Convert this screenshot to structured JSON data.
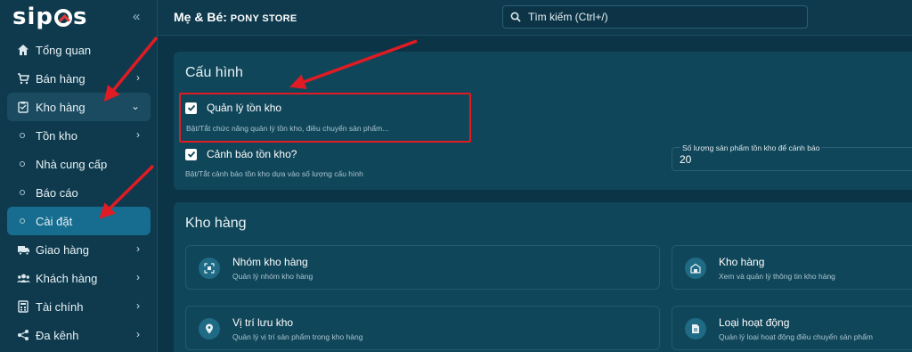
{
  "brand": {
    "logo_text": "sipos",
    "accent": "#e53935"
  },
  "sidebar": {
    "items": [
      {
        "label": "Tổng quan",
        "icon": "home-icon"
      },
      {
        "label": "Bán hàng",
        "icon": "cart-icon"
      },
      {
        "label": "Kho hàng",
        "icon": "clipboard-icon"
      },
      {
        "label": "Tồn kho"
      },
      {
        "label": "Nhà cung cấp"
      },
      {
        "label": "Báo cáo"
      },
      {
        "label": "Cài đặt"
      },
      {
        "label": "Giao hàng",
        "icon": "truck-icon"
      },
      {
        "label": "Khách hàng",
        "icon": "users-icon"
      },
      {
        "label": "Tài chính",
        "icon": "calculator-icon"
      },
      {
        "label": "Đa kênh",
        "icon": "share-icon"
      }
    ]
  },
  "topbar": {
    "store_prefix": "Mẹ & Bé: ",
    "store_name": "PONY STORE",
    "search_placeholder": "Tìm kiếm (Ctrl+/)"
  },
  "config": {
    "title": "Cấu hình",
    "inventory_mgmt_label": "Quản lý tồn kho",
    "inventory_mgmt_desc": "Bật/Tắt chức năng quản lý tồn kho, điều chuyển sản phẩm...",
    "stock_alert_label": "Cảnh báo tồn kho?",
    "stock_alert_desc": "Bật/Tắt cảnh báo tồn kho dựa vào số lượng cấu hình",
    "threshold_label": "Số lượng sản phẩm tồn kho để cảnh báo",
    "threshold_value": "20"
  },
  "warehouse": {
    "title": "Kho hàng",
    "tiles": [
      {
        "name": "Nhóm kho hàng",
        "desc": "Quản lý nhóm kho hàng",
        "icon": "group-icon"
      },
      {
        "name": "Kho hàng",
        "desc": "Xem và quản lý thông tin kho hàng",
        "icon": "warehouse-icon"
      },
      {
        "name": "Vị trí lưu kho",
        "desc": "Quản lý vị trí sản phẩm trong kho hàng",
        "icon": "location-pin-icon"
      },
      {
        "name": "Loại hoạt động",
        "desc": "Quản lý loại hoạt động điều chuyển sản phẩm",
        "icon": "document-icon"
      }
    ]
  }
}
